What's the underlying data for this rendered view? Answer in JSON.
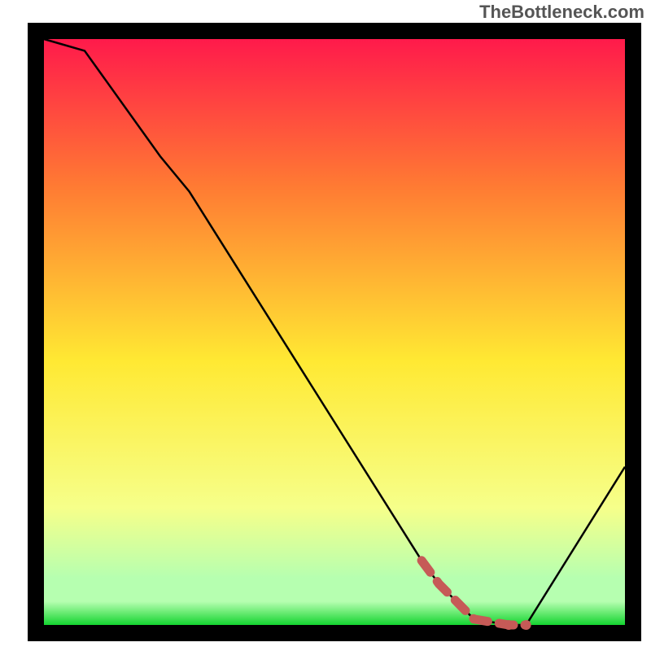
{
  "watermark": "TheBottleneck.com",
  "colors": {
    "border": "#000000",
    "curve": "#000000",
    "dashAccent": "#c65a57",
    "grad_top": "#ff1a4b",
    "grad_mid1": "#ff7a33",
    "grad_mid2": "#ffe933",
    "grad_low1": "#f6ff8a",
    "grad_low2": "#b6ffb0",
    "grad_bottom": "#14d430"
  },
  "chart_data": {
    "type": "line",
    "title": "",
    "xlabel": "",
    "ylabel": "",
    "xlim": [
      0,
      100
    ],
    "ylim": [
      0,
      100
    ],
    "series": [
      {
        "name": "bottleneck-curve",
        "x": [
          0,
          7,
          20,
          25,
          65,
          68,
          74,
          80,
          83,
          100
        ],
        "y": [
          100,
          98,
          80,
          74,
          11,
          7,
          1,
          0,
          0,
          27
        ]
      }
    ],
    "accent_segment": {
      "name": "highlight",
      "style": "dashed",
      "x": [
        65,
        68,
        74,
        80,
        83
      ],
      "y": [
        11,
        7,
        1,
        0,
        0
      ]
    },
    "gradient_stops_pct_from_top": [
      0,
      25,
      55,
      80,
      92,
      96,
      100
    ]
  }
}
